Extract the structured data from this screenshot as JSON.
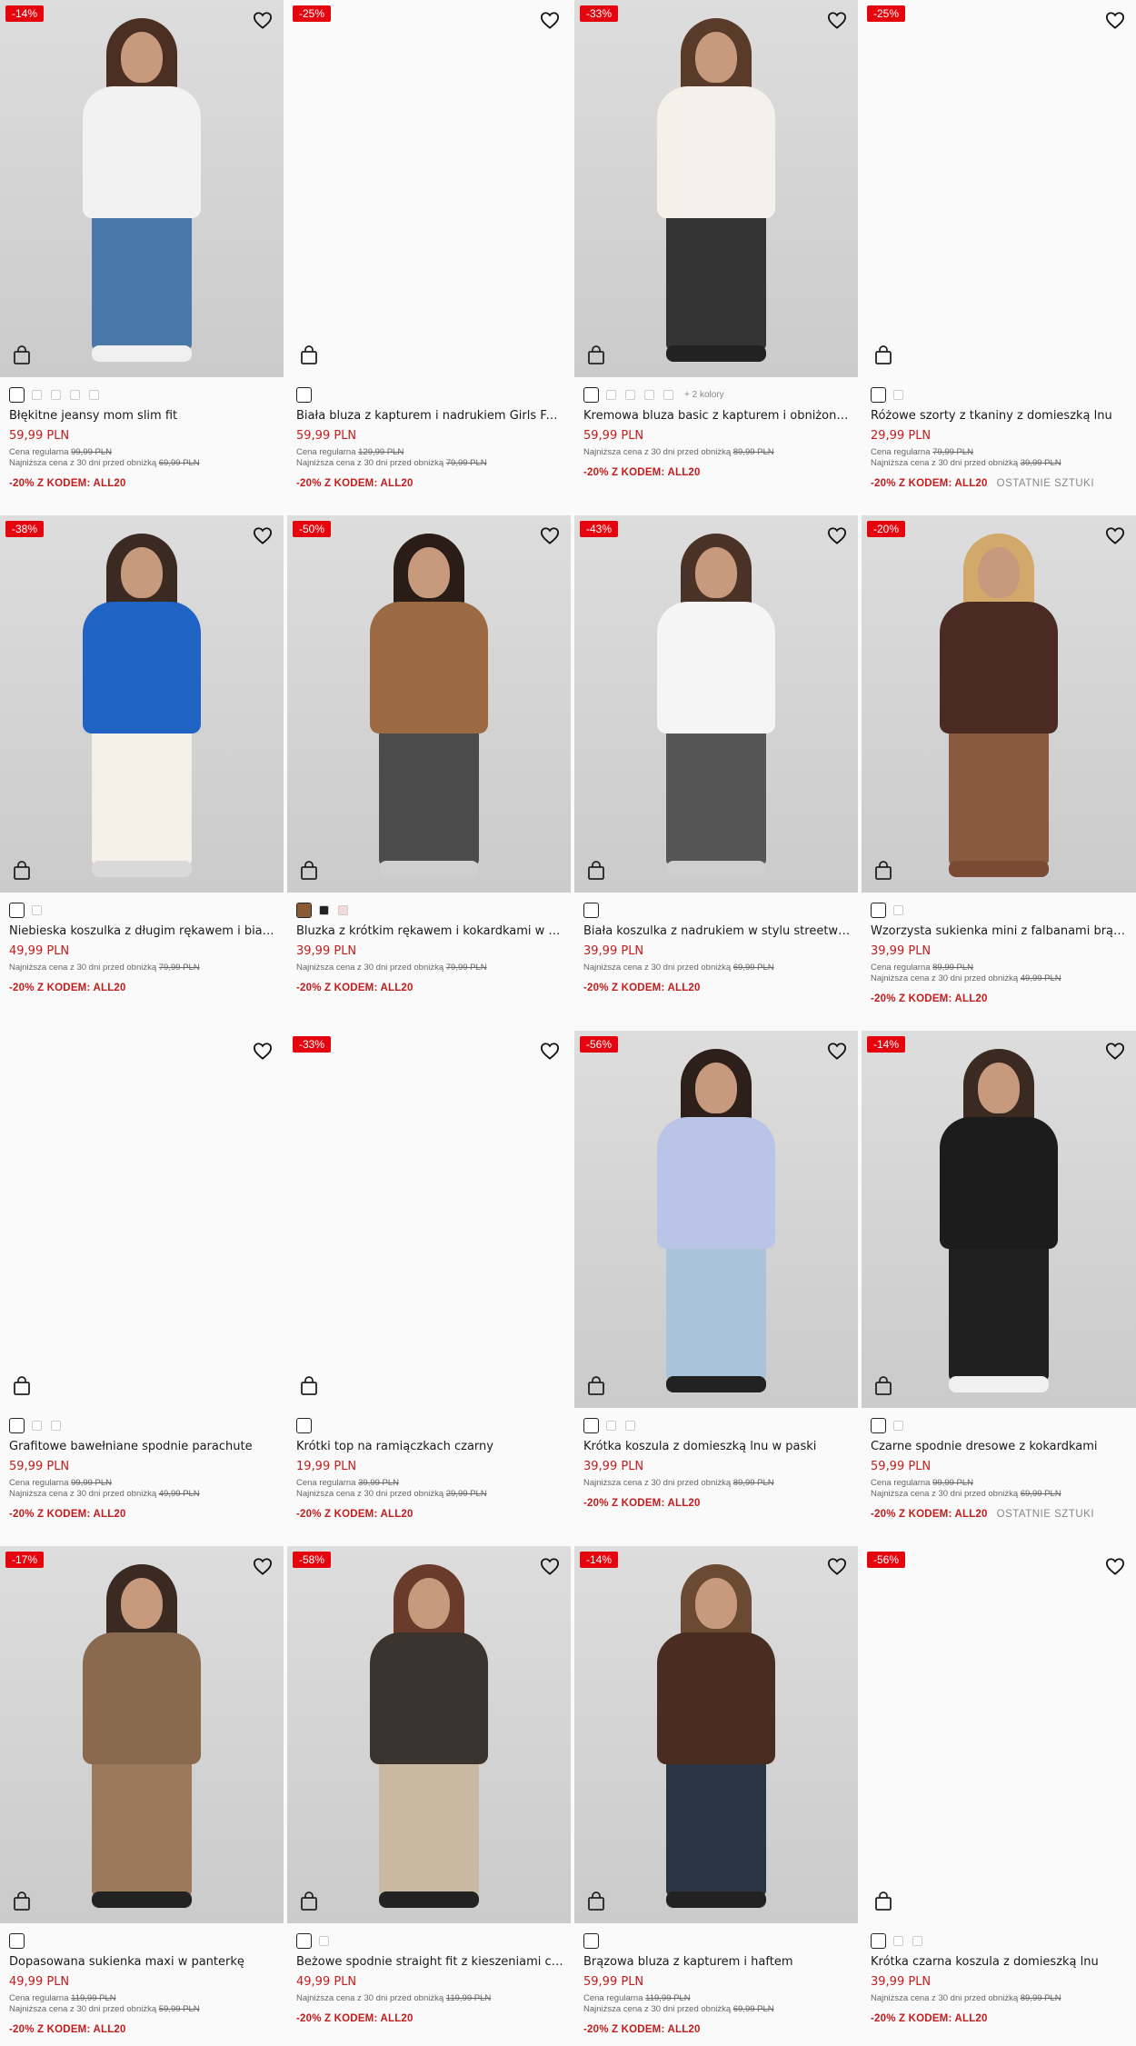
{
  "labels": {
    "regular_prefix": "Cena regularna",
    "lowest_prefix": "Najniższa cena z 30 dni przed obniżką",
    "promo": "-20% Z KODEM: ALL20",
    "last_items": "OSTATNIE SZTUKI"
  },
  "products": [
    {
      "discount": "-14%",
      "title": "Błękitne jeansy mom slim fit",
      "price": "59,99 PLN",
      "regular": "99,99 PLN",
      "lowest": "69,99 PLN",
      "last": "",
      "swatch_count": 5,
      "extra_colors": "",
      "photo": {
        "top": "#f2f2f2",
        "bottom": "#4a78a8",
        "hair": "#4a2f22",
        "feet": "#f0f0f0"
      }
    },
    {
      "discount": "-25%",
      "title": "Biała bluza z kapturem i nadrukiem Girls Favs",
      "price": "59,99 PLN",
      "regular": "129,99 PLN",
      "lowest": "79,99 PLN",
      "last": "",
      "swatch_count": 1,
      "extra_colors": "",
      "photo": null
    },
    {
      "discount": "-33%",
      "title": "Kremowa bluza basic z kapturem i obniżoną linią ramion",
      "price": "59,99 PLN",
      "regular": "",
      "lowest": "89,99 PLN",
      "last": "",
      "swatch_count": 5,
      "extra_colors": "+ 2 kolory",
      "photo": {
        "top": "#f4f1ea",
        "bottom": "#333333",
        "hair": "#5a3a28",
        "feet": "#222222"
      }
    },
    {
      "discount": "-25%",
      "title": "Różowe szorty z tkaniny z domieszką lnu",
      "price": "29,99 PLN",
      "regular": "79,99 PLN",
      "lowest": "39,99 PLN",
      "last": "OSTATNIE SZTUKI",
      "swatch_count": 2,
      "extra_colors": "",
      "photo": null
    },
    {
      "discount": "-38%",
      "title": "Niebieska koszulka z długim rękawem i białymi lampasami",
      "price": "49,99 PLN",
      "regular": "",
      "lowest": "79,99 PLN",
      "last": "",
      "swatch_count": 2,
      "extra_colors": "",
      "photo": {
        "top": "#1f63c4",
        "bottom": "#f4f0e8",
        "hair": "#3a2a22",
        "feet": "#d9d9d9"
      }
    },
    {
      "discount": "-50%",
      "title": "Bluzka z krótkim rękawem i kokardkami w panterkę",
      "price": "39,99 PLN",
      "regular": "",
      "lowest": "79,99 PLN",
      "last": "",
      "swatch_count": 3,
      "extra_colors": "",
      "swatch_colors": [
        "#8a5a36",
        "#222222",
        "#f1d9d9"
      ],
      "photo": {
        "top": "#9b6a43",
        "bottom": "#4b4b4b",
        "hair": "#2a1d18",
        "feet": "#cfcfcf"
      }
    },
    {
      "discount": "-43%",
      "title": "Biała koszulka z nadrukiem w stylu streetwear",
      "price": "39,99 PLN",
      "regular": "",
      "lowest": "69,99 PLN",
      "last": "",
      "swatch_count": 1,
      "extra_colors": "",
      "photo": {
        "top": "#f5f5f5",
        "bottom": "#555555",
        "hair": "#4b3226",
        "feet": "#cfcfcf"
      }
    },
    {
      "discount": "-20%",
      "title": "Wzorzysta sukienka mini z falbanami brązowa",
      "price": "39,99 PLN",
      "regular": "89,99 PLN",
      "lowest": "49,99 PLN",
      "last": "",
      "swatch_count": 2,
      "extra_colors": "",
      "photo": {
        "top": "#4a2a22",
        "bottom": "#8a5a3e",
        "hair": "#d2a96b",
        "feet": "#7a4a32"
      }
    },
    {
      "discount": "",
      "title": "Grafitowe bawełniane spodnie parachute",
      "price": "59,99 PLN",
      "regular": "99,99 PLN",
      "lowest": "49,99 PLN",
      "last": "",
      "swatch_count": 3,
      "extra_colors": "",
      "photo": null
    },
    {
      "discount": "-33%",
      "title": "Krótki top na ramiączkach czarny",
      "price": "19,99 PLN",
      "regular": "39,99 PLN",
      "lowest": "29,99 PLN",
      "last": "",
      "swatch_count": 1,
      "extra_colors": "",
      "photo": null
    },
    {
      "discount": "-56%",
      "title": "Krótka koszula z domieszką lnu w paski",
      "price": "39,99 PLN",
      "regular": "",
      "lowest": "89,99 PLN",
      "last": "",
      "swatch_count": 3,
      "extra_colors": "",
      "photo": {
        "top": "#b9c4e6",
        "bottom": "#a9c3da",
        "hair": "#2d1f19",
        "feet": "#222222"
      }
    },
    {
      "discount": "-14%",
      "title": "Czarne spodnie dresowe z kokardkami",
      "price": "59,99 PLN",
      "regular": "99,99 PLN",
      "lowest": "69,99 PLN",
      "last": "OSTATNIE SZTUKI",
      "swatch_count": 2,
      "extra_colors": "",
      "photo": {
        "top": "#1c1c1c",
        "bottom": "#202020",
        "hair": "#3a2a22",
        "feet": "#f0f0f0"
      }
    },
    {
      "discount": "-17%",
      "title": "Dopasowana sukienka maxi w panterkę",
      "price": "49,99 PLN",
      "regular": "119,99 PLN",
      "lowest": "59,99 PLN",
      "last": "",
      "swatch_count": 1,
      "extra_colors": "",
      "photo": {
        "top": "#8a6a4e",
        "bottom": "#9b7a5c",
        "hair": "#3a2a22",
        "feet": "#222222"
      }
    },
    {
      "discount": "-58%",
      "title": "Beżowe spodnie straight fit z kieszeniami cargo",
      "price": "49,99 PLN",
      "regular": "",
      "lowest": "119,99 PLN",
      "last": "",
      "swatch_count": 2,
      "extra_colors": "",
      "photo": {
        "top": "#3b332d",
        "bottom": "#c9b9a3",
        "hair": "#6a3a2a",
        "feet": "#222222"
      }
    },
    {
      "discount": "-14%",
      "title": "Brązowa bluza z kapturem i haftem",
      "price": "59,99 PLN",
      "regular": "119,99 PLN",
      "lowest": "69,99 PLN",
      "last": "",
      "swatch_count": 1,
      "extra_colors": "",
      "photo": {
        "top": "#4a2c20",
        "bottom": "#2b3444",
        "hair": "#6a4a32",
        "feet": "#222222"
      }
    },
    {
      "discount": "-56%",
      "title": "Krótka czarna koszula z domieszką lnu",
      "price": "39,99 PLN",
      "regular": "",
      "lowest": "89,99 PLN",
      "last": "",
      "swatch_count": 3,
      "extra_colors": "",
      "photo": null
    }
  ]
}
